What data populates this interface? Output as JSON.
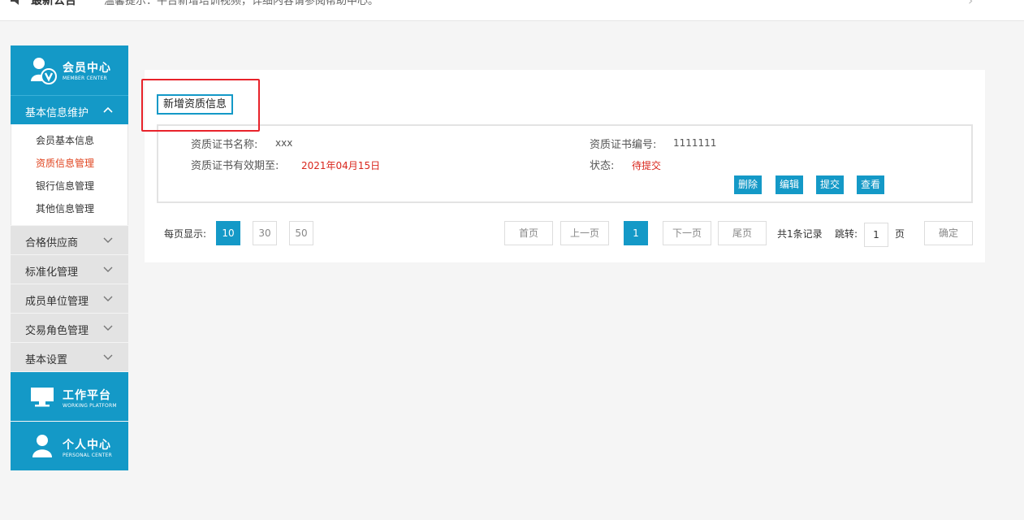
{
  "topbar": {
    "title": "最新公告",
    "message": "温馨提示：平台新增培训视频，详细内容请参阅帮助中心。"
  },
  "sidebar": {
    "header": {
      "title": "会员中心",
      "subtitle": "MEMBER CENTER"
    },
    "open_group": {
      "label": "基本信息维护",
      "items": [
        {
          "label": "会员基本信息"
        },
        {
          "label": "资质信息管理"
        },
        {
          "label": "银行信息管理"
        },
        {
          "label": "其他信息管理"
        }
      ]
    },
    "groups": [
      {
        "label": "合格供应商"
      },
      {
        "label": "标准化管理"
      },
      {
        "label": "成员单位管理"
      },
      {
        "label": "交易角色管理"
      },
      {
        "label": "基本设置"
      }
    ],
    "blocks": [
      {
        "title": "工作平台",
        "subtitle": "WORKING PLATFORM"
      },
      {
        "title": "个人中心",
        "subtitle": "PERSONAL CENTER"
      }
    ]
  },
  "main": {
    "add_button": "新增资质信息",
    "record": {
      "name_label": "资质证书名称:",
      "name_value": "xxx",
      "number_label": "资质证书编号:",
      "number_value": "1111111",
      "expiry_label": "资质证书有效期至:",
      "expiry_value": "2021年04月15日",
      "status_label": "状态:",
      "status_value": "待提交",
      "actions": {
        "delete": "删除",
        "edit": "编辑",
        "submit": "提交",
        "view": "查看"
      }
    },
    "pagination": {
      "per_page_label": "每页显示:",
      "per_page_options": [
        "10",
        "30",
        "50"
      ],
      "first": "首页",
      "prev": "上一页",
      "current": "1",
      "next": "下一页",
      "last": "尾页",
      "total": "共1条记录",
      "jump_label": "跳转:",
      "jump_value": "1",
      "page_unit": "页",
      "confirm": "确定"
    }
  },
  "colors": {
    "primary": "#1499c7",
    "active_text": "#e0441f",
    "value_red": "#d9261c",
    "highlight": "#e8232b"
  }
}
